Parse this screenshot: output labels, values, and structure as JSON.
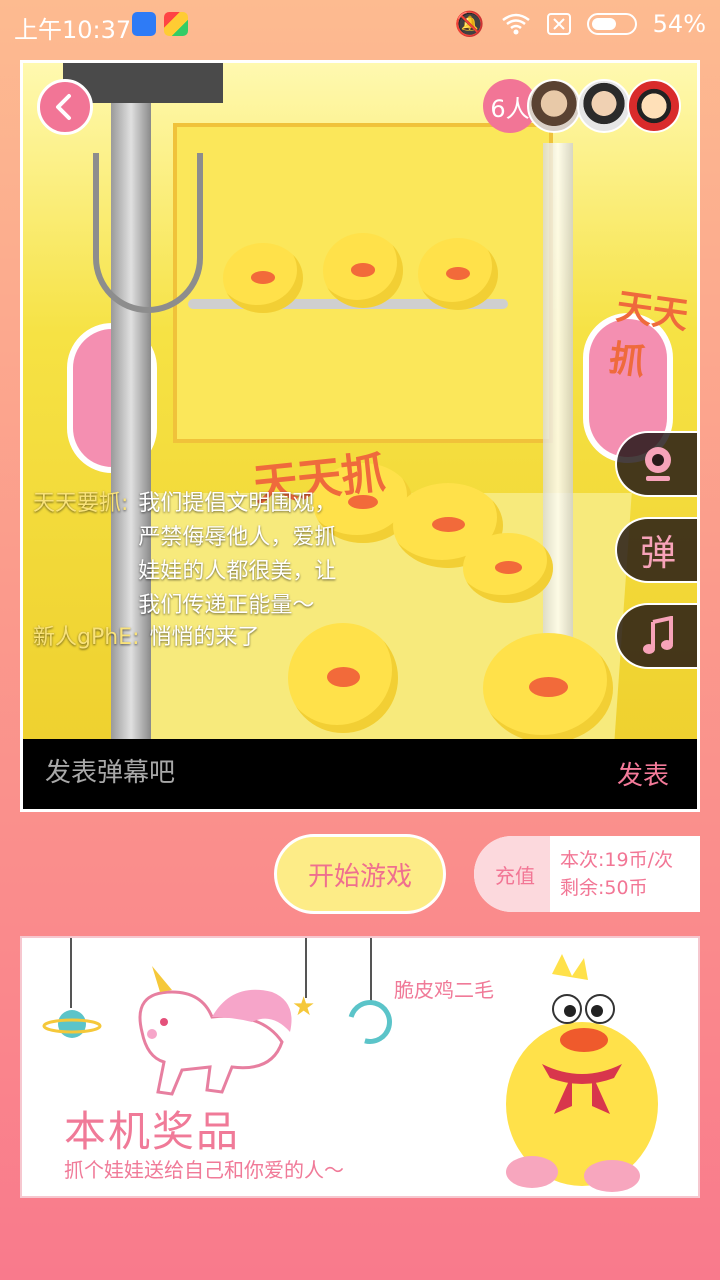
{
  "status_bar": {
    "time": "上午10:37",
    "battery": "54%"
  },
  "room": {
    "viewer_count": "6人",
    "danmu": [
      {
        "nick": "天天要抓:",
        "text": "我们提倡文明围观，严禁侮辱他人，爱抓娃娃的人都很美，让我们传递正能量～"
      },
      {
        "nick": "新人gPhE:",
        "text": "悄悄的来了"
      }
    ],
    "side_buttons": {
      "barrage_label": "弹"
    },
    "comment": {
      "placeholder": "发表弹幕吧",
      "send_label": "发表"
    }
  },
  "controls": {
    "start_label": "开始游戏",
    "recharge_label": "充值",
    "price_line": "本次:19币/次",
    "balance_line": "剩余:50币"
  },
  "prize": {
    "name": "脆皮鸡二毛",
    "title": "本机奖品",
    "subtitle": "抓个娃娃送给自己和你爱的人～"
  },
  "colors": {
    "accent_pink": "#f27596",
    "start_yellow": "#fdec87"
  }
}
